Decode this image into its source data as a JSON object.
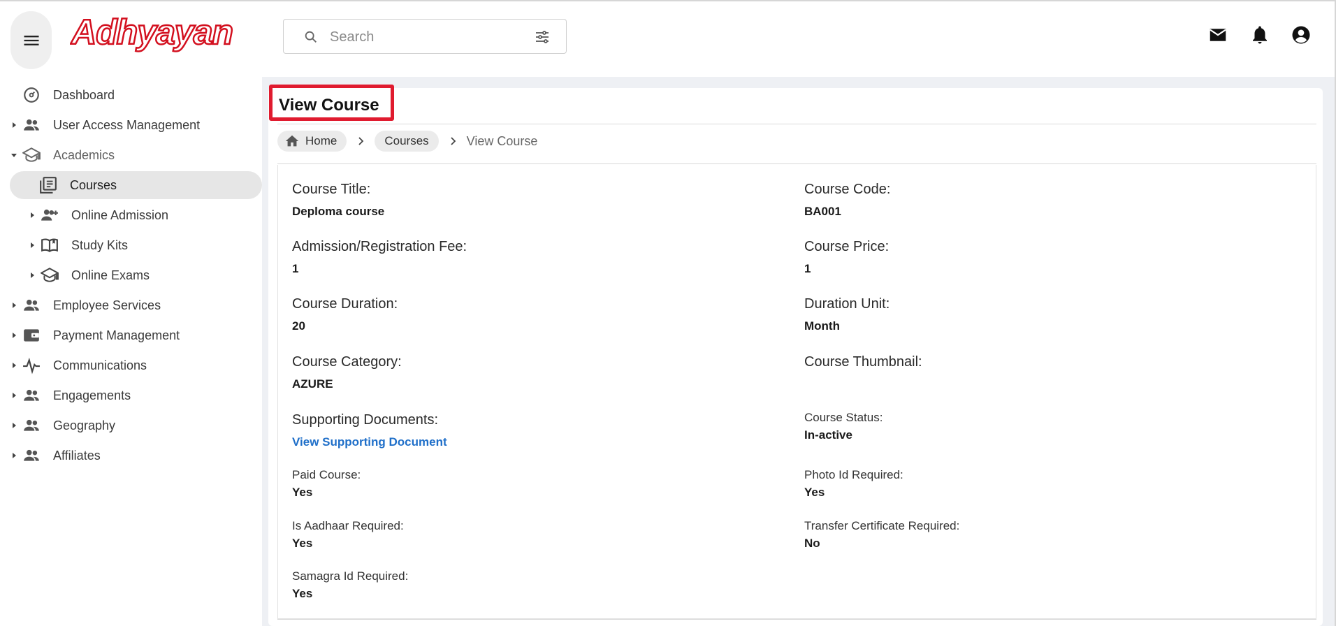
{
  "header": {
    "logo_text": "Adhyayan",
    "search_placeholder": "Search",
    "brand_color": "#d3101f"
  },
  "sidebar": {
    "items": [
      {
        "label": "Dashboard"
      },
      {
        "label": "User Access Management"
      },
      {
        "label": "Academics"
      },
      {
        "label": "Courses"
      },
      {
        "label": "Online Admission"
      },
      {
        "label": "Study Kits"
      },
      {
        "label": "Online Exams"
      },
      {
        "label": "Employee Services"
      },
      {
        "label": "Payment Management"
      },
      {
        "label": "Communications"
      },
      {
        "label": "Engagements"
      },
      {
        "label": "Geography"
      },
      {
        "label": "Affiliates"
      }
    ]
  },
  "page": {
    "title": "View Course",
    "breadcrumb": {
      "home": "Home",
      "courses": "Courses",
      "current": "View Course"
    },
    "highlight_color": "#e01b2f"
  },
  "course": {
    "title_label": "Course Title:",
    "title_value": "Deploma course",
    "code_label": "Course Code:",
    "code_value": "BA001",
    "fee_label": "Admission/Registration Fee:",
    "fee_value": "1",
    "price_label": "Course Price:",
    "price_value": "1",
    "duration_label": "Course Duration:",
    "duration_value": "20",
    "unit_label": "Duration Unit:",
    "unit_value": "Month",
    "category_label": "Course Category:",
    "category_value": "AZURE",
    "thumbnail_label": "Course Thumbnail:",
    "docs_label": "Supporting Documents:",
    "docs_link": "View Supporting Document",
    "status_label": "Course Status:",
    "status_value": "In-active",
    "paid_label": "Paid Course:",
    "paid_value": "Yes",
    "photo_label": "Photo Id Required:",
    "photo_value": "Yes",
    "aadhaar_label": "Is Aadhaar Required:",
    "aadhaar_value": "Yes",
    "tc_label": "Transfer Certificate Required:",
    "tc_value": "No",
    "samagra_label": "Samagra Id Required:",
    "samagra_value": "Yes"
  }
}
